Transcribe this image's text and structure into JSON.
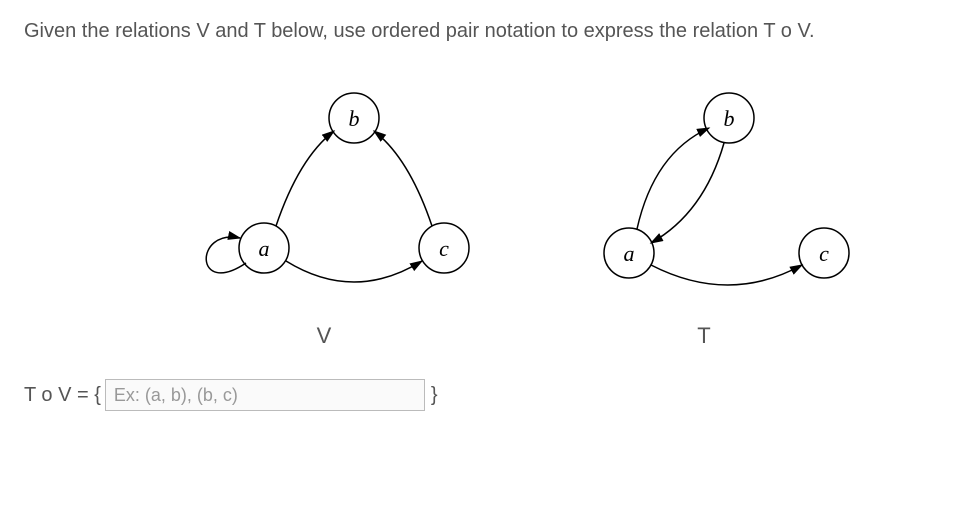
{
  "question": "Given the relations V and T below, use ordered pair notation to express the relation T o V.",
  "diagrams": {
    "V": {
      "label": "V",
      "nodes": {
        "a": "a",
        "b": "b",
        "c": "c"
      },
      "edges": [
        {
          "from": "a",
          "to": "a"
        },
        {
          "from": "a",
          "to": "b"
        },
        {
          "from": "a",
          "to": "c"
        },
        {
          "from": "c",
          "to": "b"
        }
      ]
    },
    "T": {
      "label": "T",
      "nodes": {
        "a": "a",
        "b": "b",
        "c": "c"
      },
      "edges": [
        {
          "from": "a",
          "to": "b"
        },
        {
          "from": "b",
          "to": "a"
        },
        {
          "from": "a",
          "to": "c"
        }
      ]
    }
  },
  "answer": {
    "prefix": "T o V = {",
    "placeholder": "Ex: (a, b), (b, c)",
    "suffix": "}",
    "value": ""
  },
  "chart_data": [
    {
      "type": "graph",
      "name": "V",
      "nodes": [
        "a",
        "b",
        "c"
      ],
      "edges": [
        [
          "a",
          "a"
        ],
        [
          "a",
          "b"
        ],
        [
          "a",
          "c"
        ],
        [
          "c",
          "b"
        ]
      ]
    },
    {
      "type": "graph",
      "name": "T",
      "nodes": [
        "a",
        "b",
        "c"
      ],
      "edges": [
        [
          "a",
          "b"
        ],
        [
          "b",
          "a"
        ],
        [
          "a",
          "c"
        ]
      ]
    }
  ]
}
